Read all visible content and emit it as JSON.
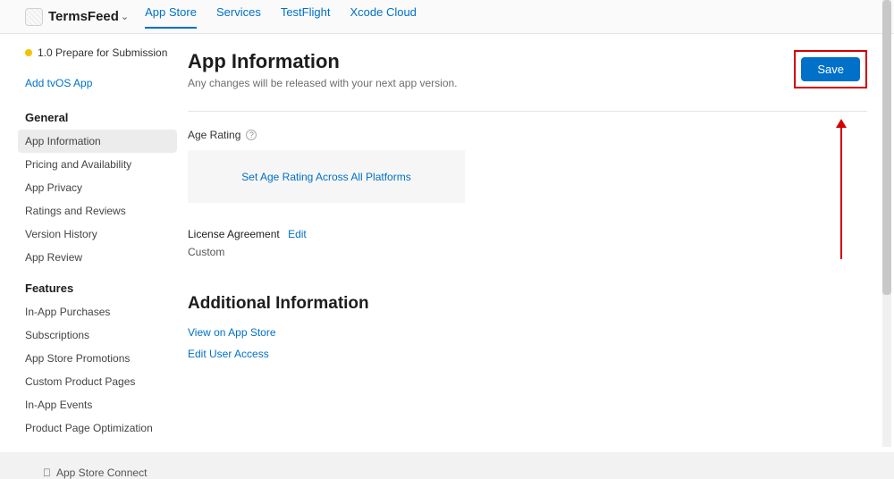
{
  "header": {
    "app_name": "TermsFeed",
    "tabs": [
      "App Store",
      "Services",
      "TestFlight",
      "Xcode Cloud"
    ],
    "active_tab": 0
  },
  "sidebar": {
    "status": "1.0 Prepare for Submission",
    "add_tvos": "Add tvOS App",
    "sections": [
      {
        "title": "General",
        "items": [
          "App Information",
          "Pricing and Availability",
          "App Privacy",
          "Ratings and Reviews",
          "Version History",
          "App Review"
        ],
        "active": 0
      },
      {
        "title": "Features",
        "items": [
          "In-App Purchases",
          "Subscriptions",
          "App Store Promotions",
          "Custom Product Pages",
          "In-App Events",
          "Product Page Optimization"
        ]
      }
    ]
  },
  "main": {
    "title": "App Information",
    "subtitle": "Any changes will be released with your next app version.",
    "save_label": "Save",
    "age_rating_label": "Age Rating",
    "age_rating_link": "Set Age Rating Across All Platforms",
    "license_label": "License Agreement",
    "license_edit": "Edit",
    "license_value": "Custom",
    "additional_title": "Additional Information",
    "links": [
      "View on App Store",
      "Edit User Access"
    ]
  },
  "footer": {
    "text": "App Store Connect"
  }
}
